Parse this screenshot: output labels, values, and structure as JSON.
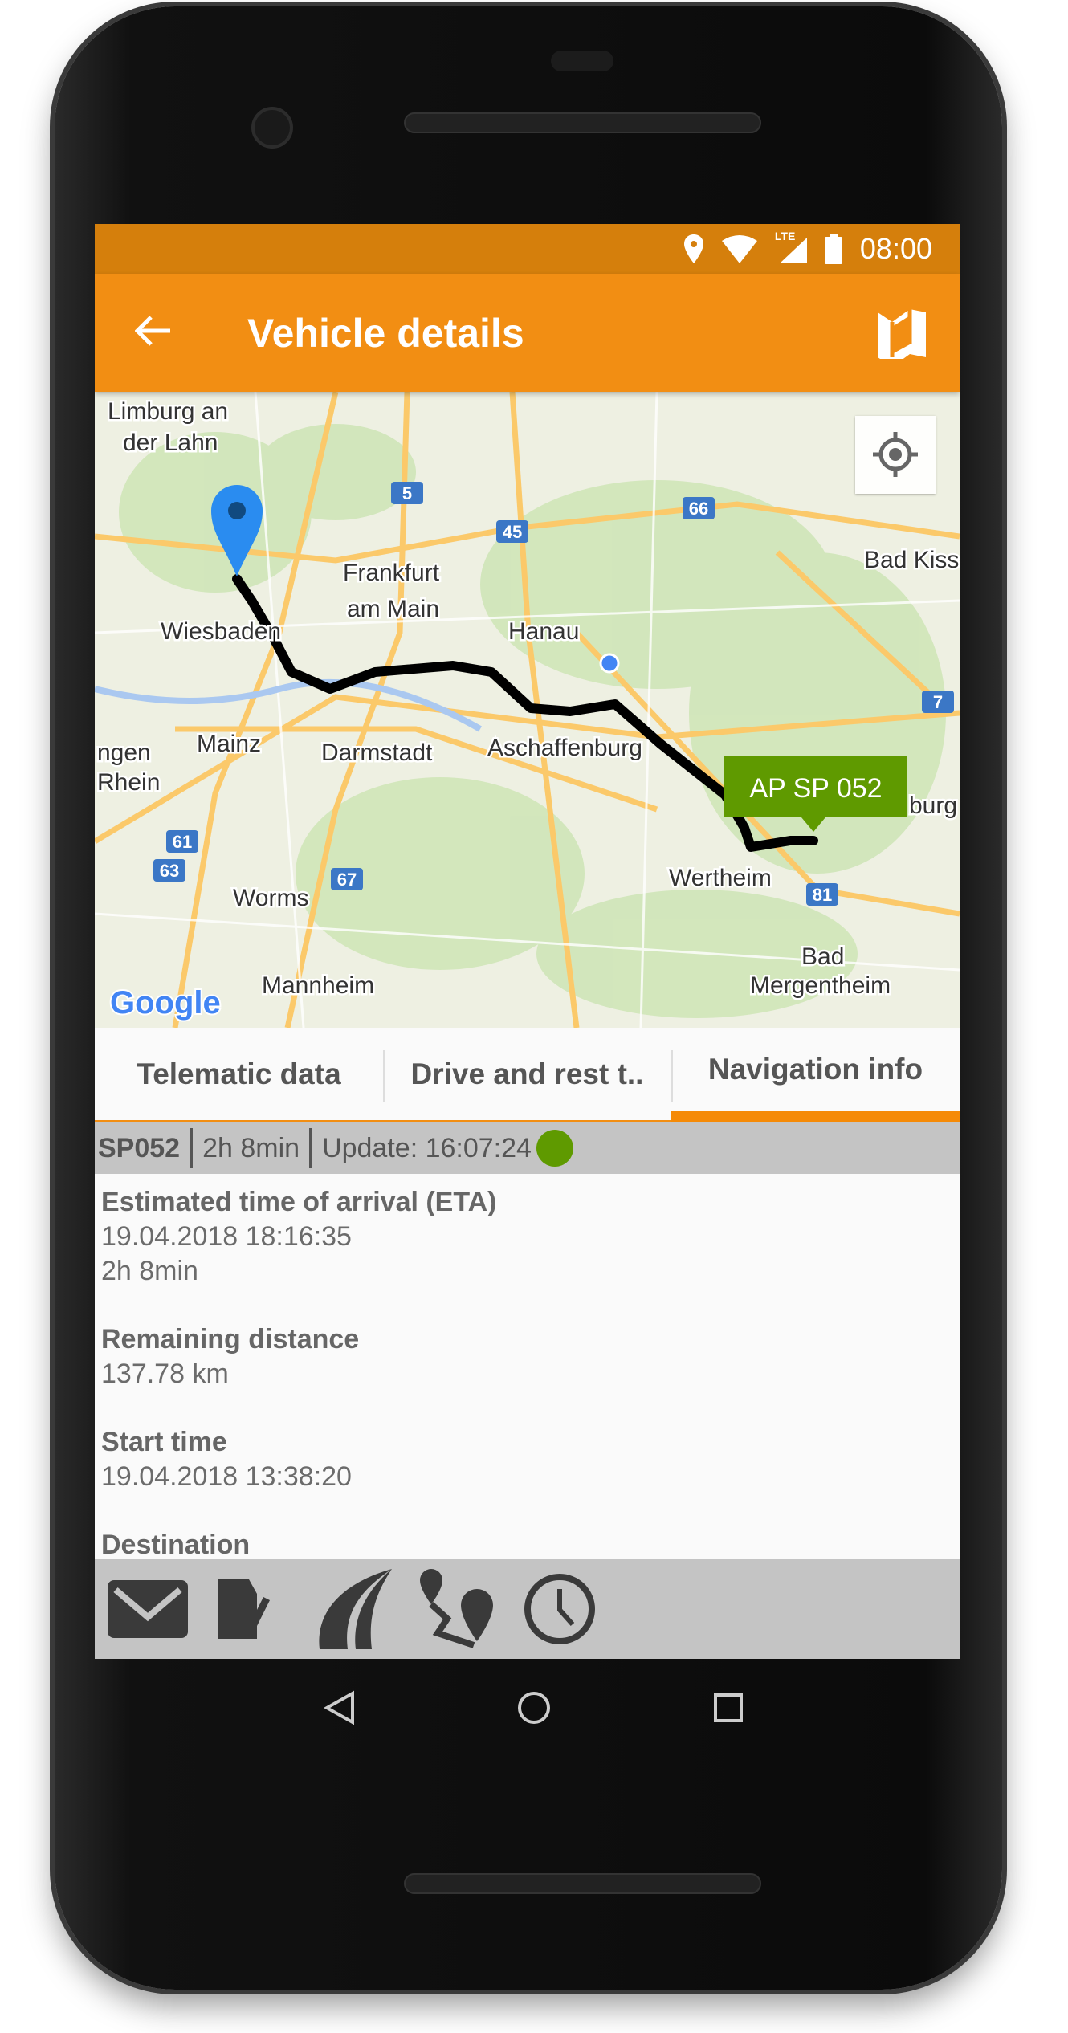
{
  "status_bar": {
    "time": "08:00",
    "network": "LTE"
  },
  "app_bar": {
    "title": "Vehicle details",
    "back_icon": "arrow-left-icon",
    "action_icon": "map-icon"
  },
  "map": {
    "labels": [
      "Limburg an",
      "der Lahn",
      "Frankfurt",
      "am Main",
      "Wiesbaden",
      "Hanau",
      "Mainz",
      "Darmstadt",
      "Aschaffenburg",
      "ngen",
      "Rhein",
      "Bad Kiss",
      "burg",
      "Wertheim",
      "Worms",
      "Mannheim",
      "Bad",
      "Mergentheim"
    ],
    "highways": [
      "5",
      "45",
      "66",
      "7",
      "61",
      "63",
      "67",
      "81"
    ],
    "vehicle_callout": "AP SP 052",
    "logo": "Google",
    "route_color": "#000000",
    "callout_color": "#5f9a00"
  },
  "tabs": [
    {
      "label": "Telematic data"
    },
    {
      "label": "Drive and rest t.."
    },
    {
      "label": "Navigation info",
      "active": true
    }
  ],
  "info_bar": {
    "vehicle": "SP052",
    "duration": "2h 8min",
    "update": "Update: 16:07:24",
    "status_color": "#5f9a00"
  },
  "details": [
    {
      "label": "Estimated time of arrival (ETA)",
      "values": [
        "19.04.2018 18:16:35",
        "2h 8min"
      ]
    },
    {
      "label": "Remaining distance",
      "values": [
        "137.78 km"
      ]
    },
    {
      "label": "Start time",
      "values": [
        "19.04.2018 13:38:20"
      ]
    },
    {
      "label": "Destination",
      "values": []
    }
  ],
  "toolbar": [
    "mail-icon",
    "edit-document-icon",
    "road-icon",
    "route-icon",
    "clock-icon"
  ],
  "accent": "#f28e13"
}
